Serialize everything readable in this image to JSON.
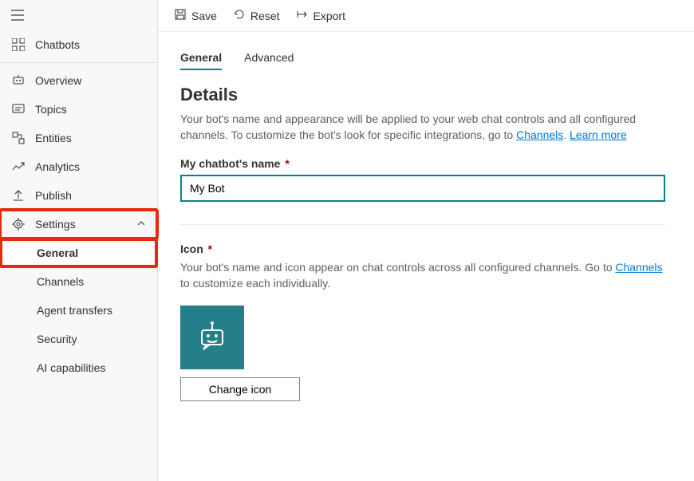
{
  "toolbar": {
    "save": "Save",
    "reset": "Reset",
    "export": "Export"
  },
  "sidebar": {
    "chatbots": "Chatbots",
    "overview": "Overview",
    "topics": "Topics",
    "entities": "Entities",
    "analytics": "Analytics",
    "publish": "Publish",
    "settings": "Settings",
    "sub": {
      "general": "General",
      "channels": "Channels",
      "agent": "Agent transfers",
      "security": "Security",
      "ai": "AI capabilities"
    }
  },
  "tabs": {
    "general": "General",
    "advanced": "Advanced"
  },
  "details": {
    "title": "Details",
    "desc_pre": "Your bot's name and appearance will be applied to your web chat controls and all configured channels. To customize the bot's look for specific integrations, go to ",
    "channels_link": "Channels",
    "learn_more": "Learn more",
    "name_label": "My chatbot's name",
    "name_value": "My Bot"
  },
  "icon": {
    "label": "Icon",
    "desc_pre": "Your bot's name and icon appear on chat controls across all configured channels. Go to ",
    "channels_link": "Channels",
    "desc_post": " to customize each individually.",
    "change_btn": "Change icon"
  }
}
